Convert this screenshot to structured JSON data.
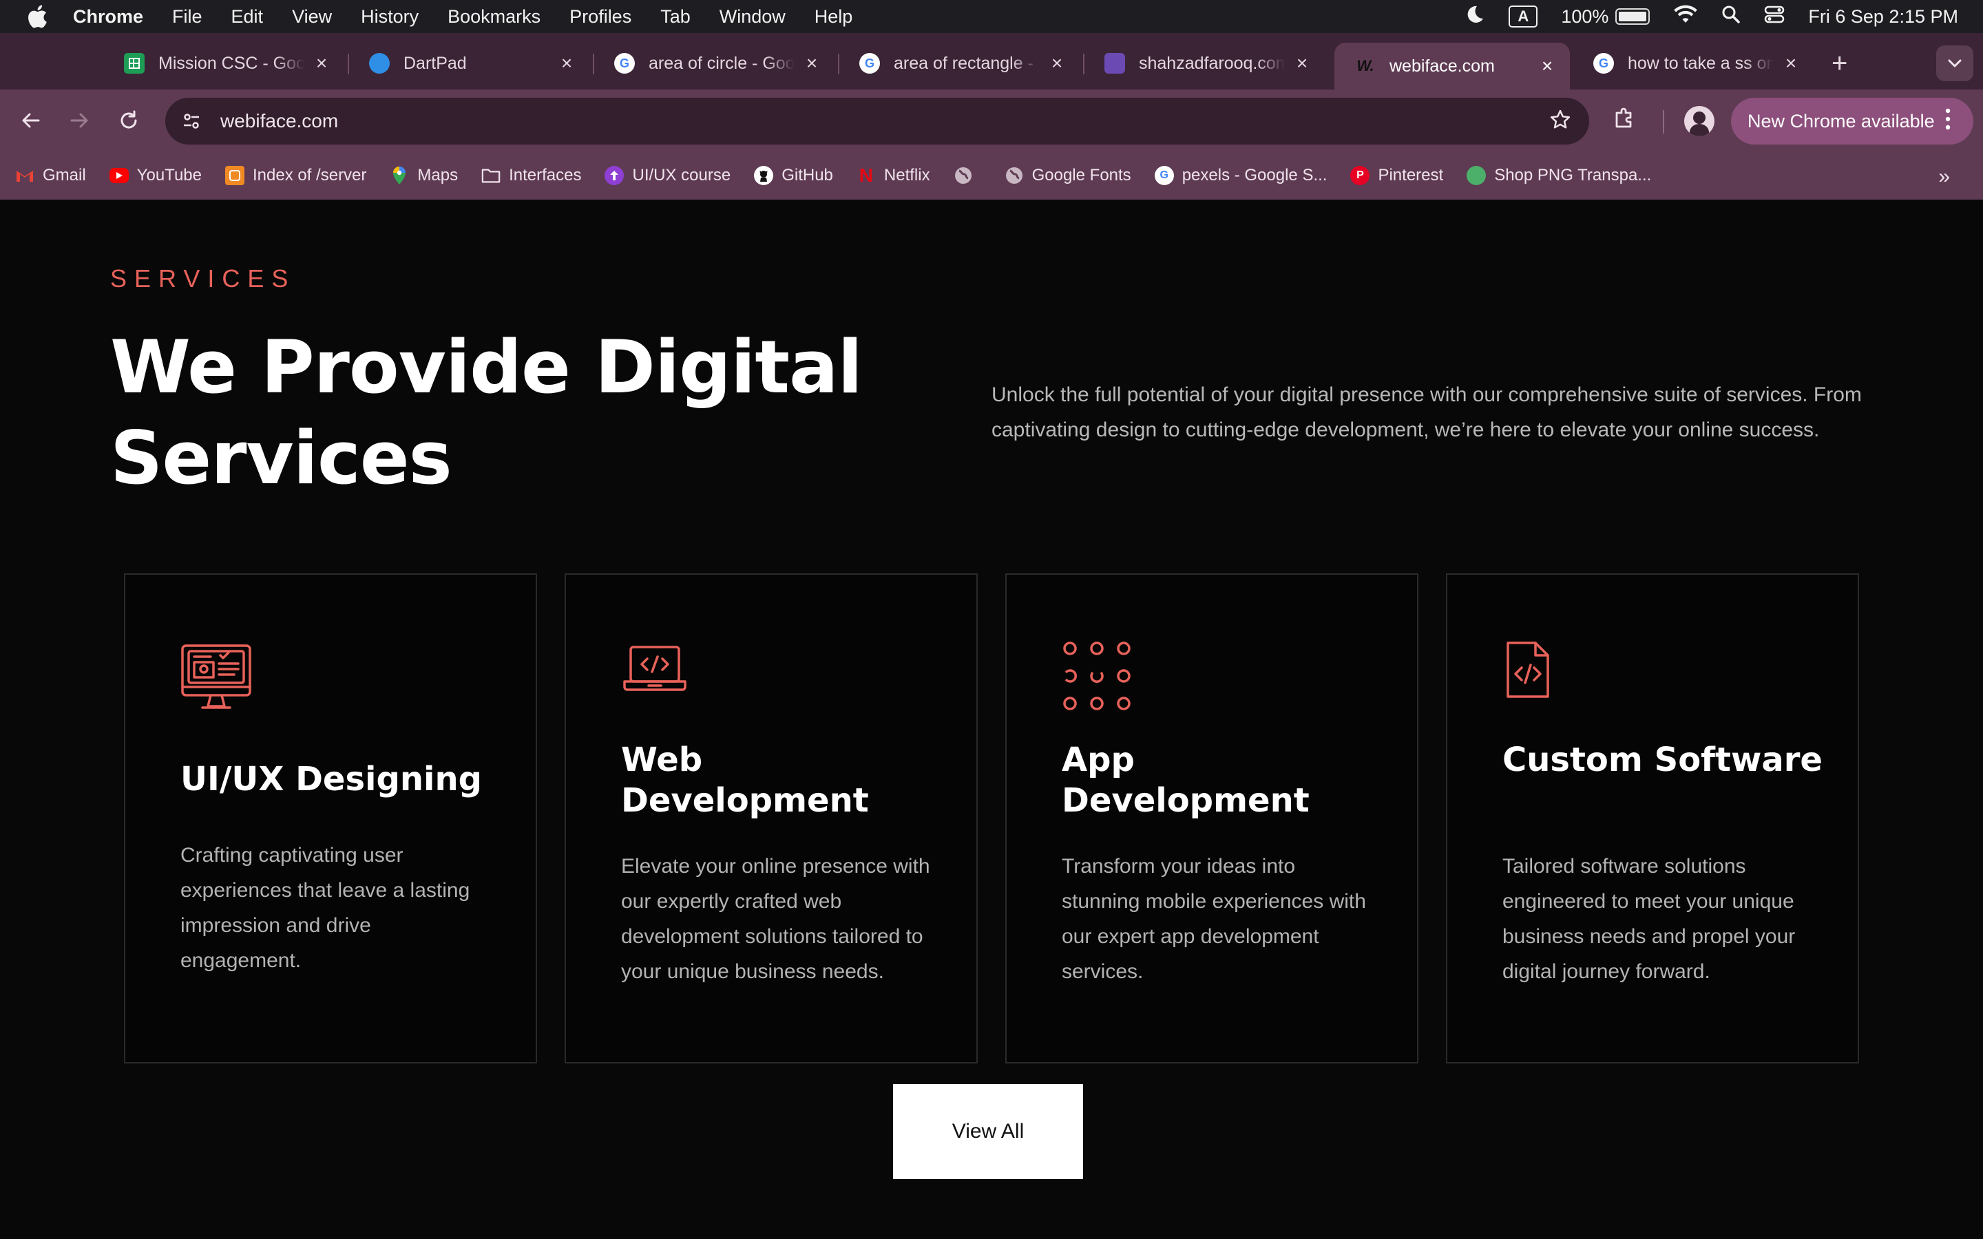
{
  "menubar": {
    "app_name": "Chrome",
    "menus": [
      "File",
      "Edit",
      "View",
      "History",
      "Bookmarks",
      "Profiles",
      "Tab",
      "Window",
      "Help"
    ],
    "keyboard_badge": "A",
    "battery": "100%",
    "datetime": "Fri 6 Sep  2:15 PM"
  },
  "tabs": [
    {
      "title": "Mission CSC - Google Sheets",
      "icon": "sheets-icon"
    },
    {
      "title": "DartPad",
      "icon": "dart-icon"
    },
    {
      "title": "area of circle - Google Search",
      "icon": "google-icon"
    },
    {
      "title": "area of rectangle - Google Search",
      "icon": "google-icon"
    },
    {
      "title": "shahzadfarooq.com",
      "icon": "site-icon"
    },
    {
      "title": "webiface.com",
      "icon": "webiface-icon",
      "active": true
    },
    {
      "title": "how to take a ss on mac",
      "icon": "google-icon"
    }
  ],
  "toolbar": {
    "url": "webiface.com",
    "new_chrome_label": "New Chrome available"
  },
  "bookmarks": [
    {
      "label": "Gmail",
      "icon": "gmail-icon"
    },
    {
      "label": "YouTube",
      "icon": "youtube-icon"
    },
    {
      "label": "Index of /server",
      "icon": "server-icon"
    },
    {
      "label": "Maps",
      "icon": "maps-icon"
    },
    {
      "label": "Interfaces",
      "icon": "folder-icon"
    },
    {
      "label": "UI/UX course",
      "icon": "course-icon"
    },
    {
      "label": "GitHub",
      "icon": "github-icon"
    },
    {
      "label": "Netflix",
      "icon": "netflix-icon"
    },
    {
      "label": "",
      "icon": "globe-icon"
    },
    {
      "label": "Google Fonts",
      "icon": "globe-icon"
    },
    {
      "label": "pexels - Google S...",
      "icon": "google-icon"
    },
    {
      "label": "Pinterest",
      "icon": "pinterest-icon"
    },
    {
      "label": "Shop PNG Transpa...",
      "icon": "png-shop-icon"
    }
  ],
  "page": {
    "eyebrow": "SERVICES",
    "headline": "We Provide Digital Services",
    "intro": "Unlock the full potential of your digital presence with our comprehensive suite of services. From captivating design to cutting-edge development, we’re here to elevate your online success.",
    "accent_color": "#e8625a",
    "services": [
      {
        "title": "UI/UX Designing",
        "description": "Crafting captivating user experiences that leave a lasting impression and drive engagement.",
        "icon": "monitor-design-icon"
      },
      {
        "title": "Web Development",
        "description": "Elevate your online presence with our expertly crafted web development solutions tailored to your unique business needs.",
        "icon": "laptop-code-icon"
      },
      {
        "title": "App Development",
        "description": "Transform your ideas into stunning mobile experiences with our expert app development services.",
        "icon": "app-grid-icon"
      },
      {
        "title": "Custom Software",
        "description": "Tailored software solutions engineered to meet your unique business needs and propel your digital journey forward.",
        "icon": "code-file-icon"
      }
    ],
    "view_all_label": "View All"
  }
}
